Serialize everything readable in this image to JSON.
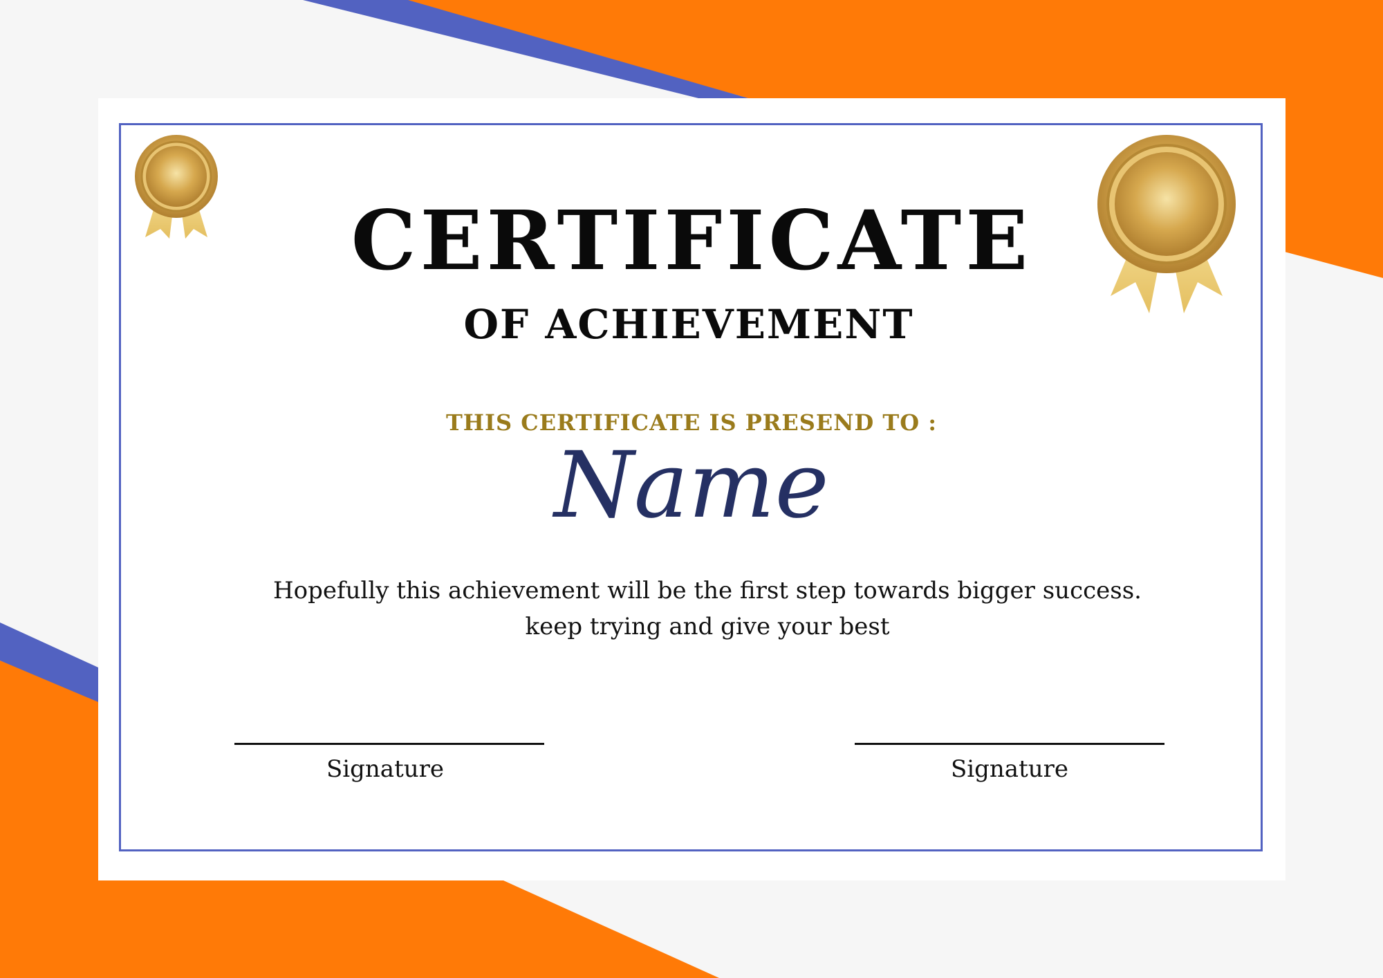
{
  "certificate": {
    "title": "CERTIFICATE",
    "subtitle": "OF ACHIEVEMENT",
    "presented_label": "THIS CERTIFICATE IS PRESEND TO :",
    "recipient_name": "Name",
    "message_line1": "Hopefully this achievement will be the first step towards bigger success.",
    "message_line2": "keep trying and give your best"
  },
  "signatures": [
    {
      "label": "Signature"
    },
    {
      "label": "Signature"
    }
  ],
  "decorations": {
    "seals": [
      "gold-medal-icon",
      "gold-medal-icon"
    ]
  },
  "colors": {
    "accent_orange": "#ff7a07",
    "accent_blue": "#5262c1",
    "gold_text": "#9a7b1c",
    "name_navy": "#253063"
  }
}
